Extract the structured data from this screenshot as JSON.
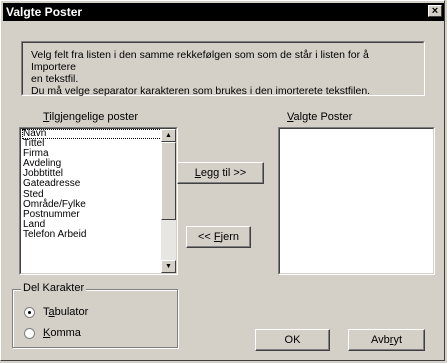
{
  "window": {
    "title": "Valgte Poster",
    "close_glyph": "×"
  },
  "info": {
    "line1": "Velg felt fra listen i den samme rekkefølgen som som de står i listen for å Importere",
    "line2": "en tekstfil.",
    "line3": "Du må velge separator karakteren som brukes i den imorterete tekstfilen."
  },
  "available": {
    "label_first": "T",
    "label_rest": "ilgjengelige poster",
    "items": [
      "Navn",
      "Tittel",
      "Firma",
      "Avdeling",
      "Jobbtittel",
      "Gateadresse",
      "Sted",
      "Område/Fylke",
      "Postnummer",
      "Land",
      "Telefon Arbeid"
    ]
  },
  "selected": {
    "label_first": "V",
    "label_rest": "algte Poster"
  },
  "buttons": {
    "add_first": "L",
    "add_rest": "egg til >>",
    "remove_pre": "<< ",
    "remove_acc": "F",
    "remove_post": "jern",
    "ok": "OK",
    "cancel_pre": "Avb",
    "cancel_acc": "r",
    "cancel_post": "yt"
  },
  "separator": {
    "group_label": "Del Karakter",
    "tab_pre": "T",
    "tab_acc": "a",
    "tab_post": "bulator",
    "comma_acc": "K",
    "comma_rest": "omma",
    "selected": "Tabulator"
  },
  "icons": {
    "scroll_up": "▲",
    "scroll_down": "▼"
  }
}
